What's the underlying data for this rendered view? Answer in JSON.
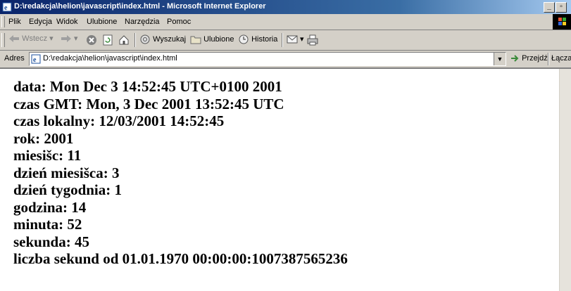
{
  "window": {
    "title": "D:\\redakcja\\helion\\javascript\\index.html - Microsoft Internet Explorer",
    "minimize_label": "_",
    "restore_label": "▫"
  },
  "menu": [
    "Plik",
    "Edycja",
    "Widok",
    "Ulubione",
    "Narzędzia",
    "Pomoc"
  ],
  "toolbar": {
    "back": "Wstecz",
    "search": "Wyszukaj",
    "favorites": "Ulubione",
    "history": "Historia"
  },
  "address": {
    "label": "Adres",
    "value": "D:\\redakcja\\helion\\javascript\\index.html",
    "go": "Przejdź",
    "links": "Łącza"
  },
  "content": {
    "lines": [
      "data: Mon Dec 3 14:52:45 UTC+0100 2001",
      "czas GMT: Mon, 3 Dec 2001 13:52:45 UTC",
      "czas lokalny: 12/03/2001 14:52:45",
      "rok: 2001",
      "miesišc: 11",
      "dzień miesišca: 3",
      "dzień tygodnia: 1",
      "godzina: 14",
      "minuta: 52",
      "sekunda: 45",
      "liczba sekund od 01.01.1970 00:00:00:1007387565236"
    ]
  },
  "icons": [
    "ie-page-icon",
    "arrow-left-icon",
    "arrow-right-icon",
    "stop-icon",
    "refresh-icon",
    "home-icon",
    "search-icon",
    "favorites-folder-icon",
    "history-icon",
    "mail-icon",
    "print-icon",
    "go-arrow-icon",
    "windows-logo-icon"
  ]
}
